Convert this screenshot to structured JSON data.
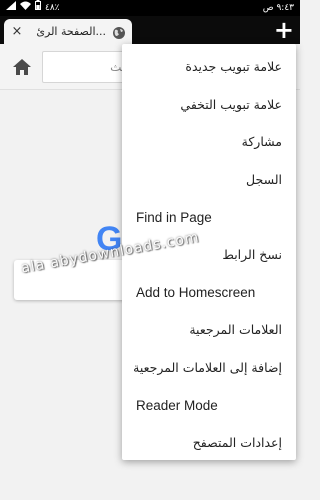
{
  "status_bar": {
    "time": "٩:٤٣ ص",
    "battery": "٤٨٪"
  },
  "tab": {
    "title": "الصفحة الرئ...",
    "close_icon": "×"
  },
  "new_tab": {
    "label": "+"
  },
  "toolbar": {
    "search_placeholder": "بحث"
  },
  "page": {
    "logo_letter": "G",
    "logo_color": "#4285F4"
  },
  "watermark": "ala abydownloads.com",
  "menu": {
    "items": [
      {
        "label": "علامة تبويب جديدة",
        "dir": "rtl"
      },
      {
        "label": "علامة تبويب التخفي",
        "dir": "rtl"
      },
      {
        "label": "مشاركة",
        "dir": "rtl"
      },
      {
        "label": "السجل",
        "dir": "rtl"
      },
      {
        "label": "Find in Page",
        "dir": "ltr"
      },
      {
        "label": "نسخ الرابط",
        "dir": "rtl"
      },
      {
        "label": "Add to Homescreen",
        "dir": "ltr"
      },
      {
        "label": "العلامات المرجعية",
        "dir": "rtl"
      },
      {
        "label": "إضافة إلى العلامات المرجعية",
        "dir": "rtl"
      },
      {
        "label": "Reader Mode",
        "dir": "ltr"
      },
      {
        "label": "إعدادات المتصفح",
        "dir": "rtl"
      }
    ]
  }
}
